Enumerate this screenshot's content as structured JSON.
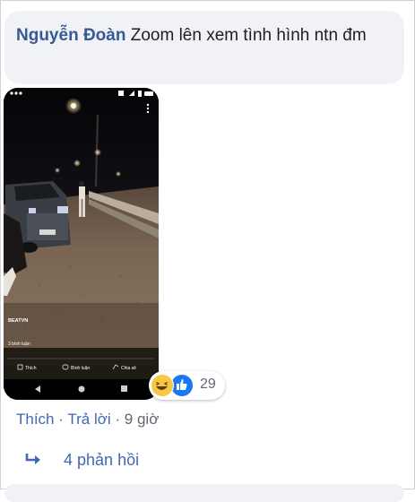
{
  "comment": {
    "author": "Nguyễn Đoàn",
    "text": "Zoom lên xem tình hình ntn đm"
  },
  "video_overlay": {
    "channel": "BEATVN",
    "comments_count": "3 bình luận",
    "like_label": "Thích",
    "comment_label": "Bình luận",
    "share_label": "Chia sẻ"
  },
  "reactions": {
    "icons": [
      "haha-icon",
      "like-icon"
    ],
    "count": "29"
  },
  "actions": {
    "like": "Thích",
    "separator": "·",
    "reply": "Trả lời",
    "time": "9 giờ"
  },
  "replies": {
    "label": "4 phản hồi",
    "icon": "reply-arrow-icon"
  },
  "colors": {
    "author": "#385898",
    "link": "#4267b2",
    "bubble": "#f0f2f5",
    "meta": "#606770",
    "like_blue": "#1877f2",
    "haha_yellow": "#f7c744"
  }
}
